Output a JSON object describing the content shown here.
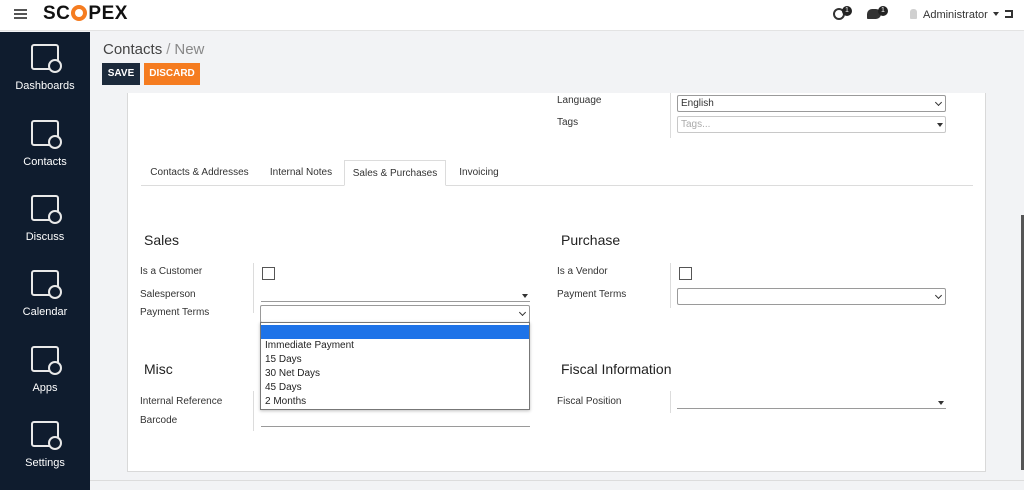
{
  "brand": {
    "logo_pre": "SC",
    "logo_post": "PEX",
    "tagline": ""
  },
  "topbar": {
    "activity_count": "1",
    "messages_count": "1",
    "user_name": "Administrator"
  },
  "sidebar": {
    "items": [
      {
        "label": "Dashboards",
        "icon": "dashboard-icon"
      },
      {
        "label": "Contacts",
        "icon": "contacts-icon"
      },
      {
        "label": "Discuss",
        "icon": "discuss-icon"
      },
      {
        "label": "Calendar",
        "icon": "calendar-icon"
      },
      {
        "label": "Apps",
        "icon": "apps-icon"
      },
      {
        "label": "Settings",
        "icon": "settings-icon"
      }
    ]
  },
  "header": {
    "breadcrumb_parent": "Contacts",
    "breadcrumb_sep": "/",
    "breadcrumb_current": "New",
    "save_label": "SAVE",
    "discard_label": "DISCARD"
  },
  "form": {
    "language_label": "Language",
    "language_value": "English",
    "tags_label": "Tags",
    "tags_placeholder": "Tags...",
    "tabs": [
      {
        "label": "Contacts & Addresses",
        "active": false
      },
      {
        "label": "Internal Notes",
        "active": false
      },
      {
        "label": "Sales & Purchases",
        "active": true
      },
      {
        "label": "Invoicing",
        "active": false
      }
    ],
    "sales": {
      "title": "Sales",
      "is_customer_label": "Is a Customer",
      "salesperson_label": "Salesperson",
      "payment_terms_label": "Payment Terms",
      "payment_terms_value": ""
    },
    "purchase": {
      "title": "Purchase",
      "is_vendor_label": "Is a Vendor",
      "payment_terms_label": "Payment Terms",
      "payment_terms_value": ""
    },
    "misc": {
      "title": "Misc",
      "internal_ref_label": "Internal Reference",
      "barcode_label": "Barcode"
    },
    "fiscal": {
      "title": "Fiscal Information",
      "fiscal_position_label": "Fiscal Position"
    },
    "payment_terms_options": [
      "",
      "Immediate Payment",
      "15 Days",
      "30 Net Days",
      "45 Days",
      "2 Months"
    ]
  },
  "colors": {
    "sidebar_bg": "#0f1c2e",
    "save_btn": "#1c2a3b",
    "discard_btn": "#f57c20",
    "dropdown_selected": "#1e73e8"
  }
}
